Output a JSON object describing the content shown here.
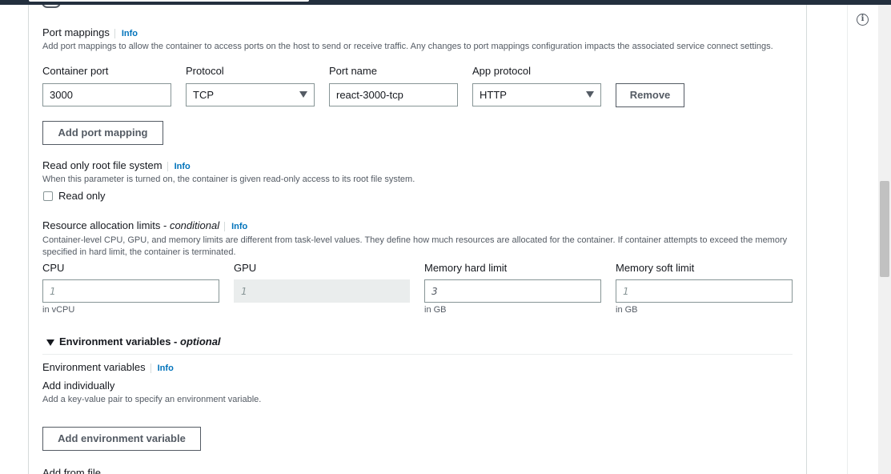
{
  "port_mappings": {
    "title": "Port mappings",
    "info": "Info",
    "description": "Add port mappings to allow the container to access ports on the host to send or receive traffic. Any changes to port mappings configuration impacts the associated service connect settings.",
    "col_container_port": "Container port",
    "col_protocol": "Protocol",
    "col_port_name": "Port name",
    "col_app_protocol": "App protocol",
    "row": {
      "container_port": "3000",
      "protocol": "TCP",
      "port_name": "react-3000-tcp",
      "app_protocol": "HTTP",
      "remove": "Remove"
    },
    "add_button": "Add port mapping"
  },
  "read_only": {
    "title": "Read only root file system",
    "info": "Info",
    "description": "When this parameter is turned on, the container is given read-only access to its root file system.",
    "checkbox_label": "Read only",
    "checked": false
  },
  "resources": {
    "title": "Resource allocation limits - ",
    "title_em": "conditional",
    "info": "Info",
    "description": "Container-level CPU, GPU, and memory limits are different from task-level values. They define how much resources are allocated for the container. If container attempts to exceed the memory specified in hard limit, the container is terminated.",
    "cpu": {
      "label": "CPU",
      "placeholder": "1",
      "hint": "in vCPU"
    },
    "gpu": {
      "label": "GPU",
      "placeholder": "1"
    },
    "mem_hard": {
      "label": "Memory hard limit",
      "value": "3",
      "hint": "in GB"
    },
    "mem_soft": {
      "label": "Memory soft limit",
      "placeholder": "1",
      "hint": "in GB"
    }
  },
  "env": {
    "section_title": "Environment variables - ",
    "section_title_em": "optional",
    "subtitle": "Environment variables",
    "info": "Info",
    "add_individually": "Add individually",
    "add_description": "Add a key-value pair to specify an environment variable.",
    "add_button": "Add environment variable",
    "add_from_file": "Add from file"
  }
}
